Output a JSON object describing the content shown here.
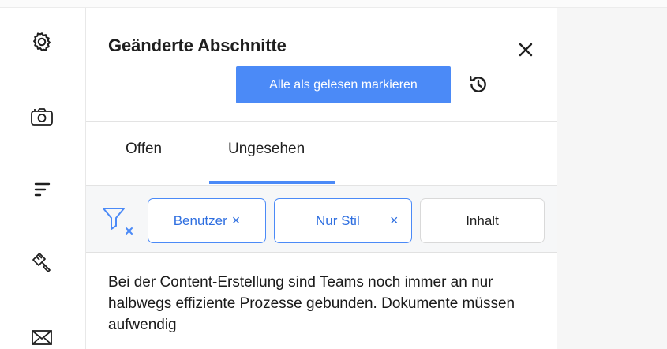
{
  "sidebar": {
    "icons": [
      "gear-icon",
      "camera-icon",
      "text-lines-icon",
      "paint-brush-icon",
      "envelope-icon"
    ]
  },
  "panel": {
    "title": "Geänderte Abschnitte",
    "mark_all_read_label": "Alle als gelesen markieren",
    "tabs": [
      {
        "label": "Offen",
        "active": false
      },
      {
        "label": "Ungesehen",
        "active": true
      }
    ],
    "filters": {
      "chips": [
        {
          "label": "Benutzer",
          "active": true,
          "removable": true
        },
        {
          "label": "Nur Stil",
          "active": true,
          "removable": true
        },
        {
          "label": "Inhalt",
          "active": false,
          "removable": false
        }
      ],
      "remove_glyph": "×"
    },
    "content_text": "Bei der Content-Erstellung sind Teams noch immer an nur halbwegs effiziente Prozesse gebunden. Dokumente müssen aufwendig"
  },
  "colors": {
    "accent": "#4b8af7",
    "accent_text": "#2f6fe0",
    "filter_bg": "#f6f7f8",
    "text": "#1f1f1f"
  }
}
